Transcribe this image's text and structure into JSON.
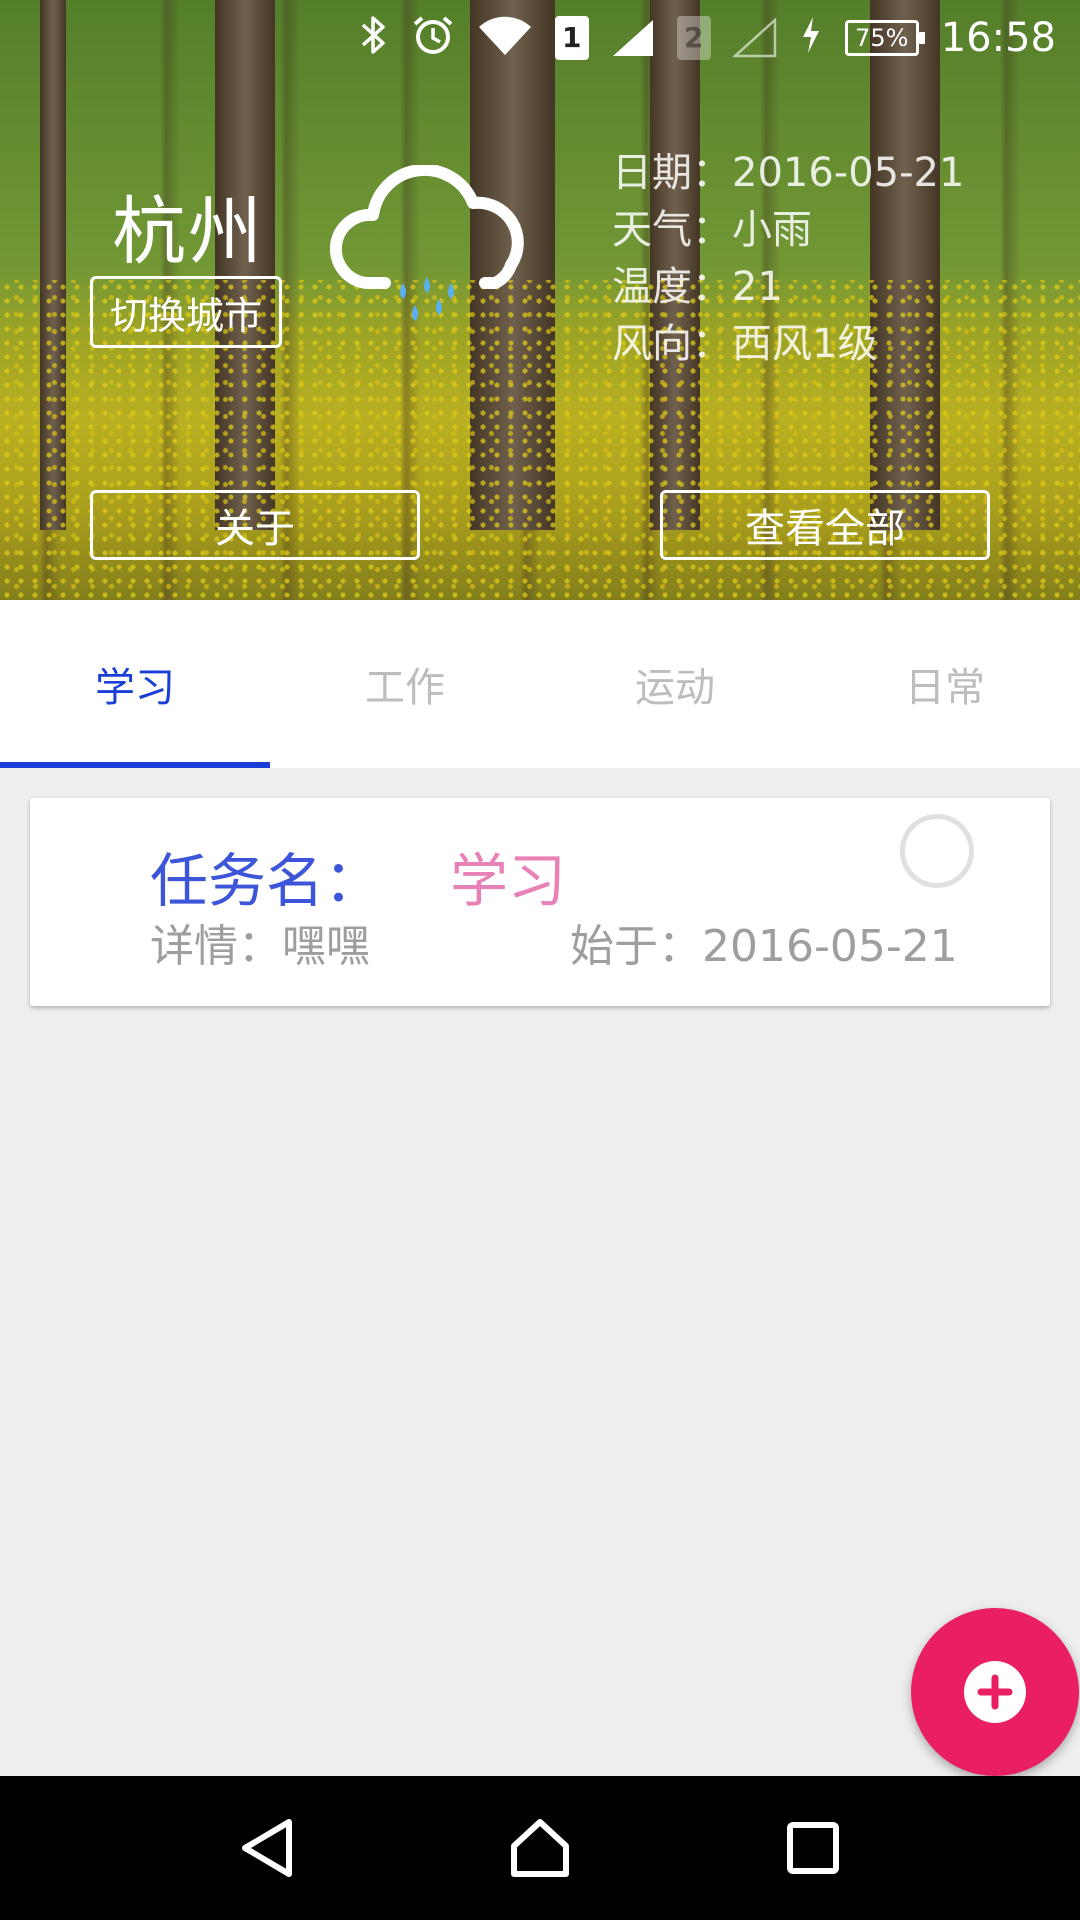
{
  "status_bar": {
    "sim1": "1",
    "sim2": "2",
    "battery": "75%",
    "time": "16:58"
  },
  "header": {
    "city": "杭州",
    "switch_city_label": "切换城市",
    "weather_icon": "cloud-rain-icon",
    "info": {
      "date": "日期：2016-05-21",
      "weather": "天气：小雨",
      "temperature": "温度：21",
      "wind": "风向：西风1级"
    },
    "about_label": "关于",
    "view_all_label": "查看全部"
  },
  "tabs": [
    {
      "label": "学习",
      "active": true
    },
    {
      "label": "工作",
      "active": false
    },
    {
      "label": "运动",
      "active": false
    },
    {
      "label": "日常",
      "active": false
    }
  ],
  "tasks": [
    {
      "name_label": "任务名：",
      "name": "学习",
      "detail": "详情：嘿嘿",
      "start": "始于：2016-05-21"
    }
  ],
  "colors": {
    "accent": "#1a3fd6",
    "task_label": "#3d55d8",
    "task_name": "#e882b6",
    "fab": "#e91e63"
  },
  "fab": {
    "icon": "plus-icon"
  },
  "navbar": {
    "icons": [
      "back-icon",
      "home-icon",
      "recents-icon"
    ]
  }
}
